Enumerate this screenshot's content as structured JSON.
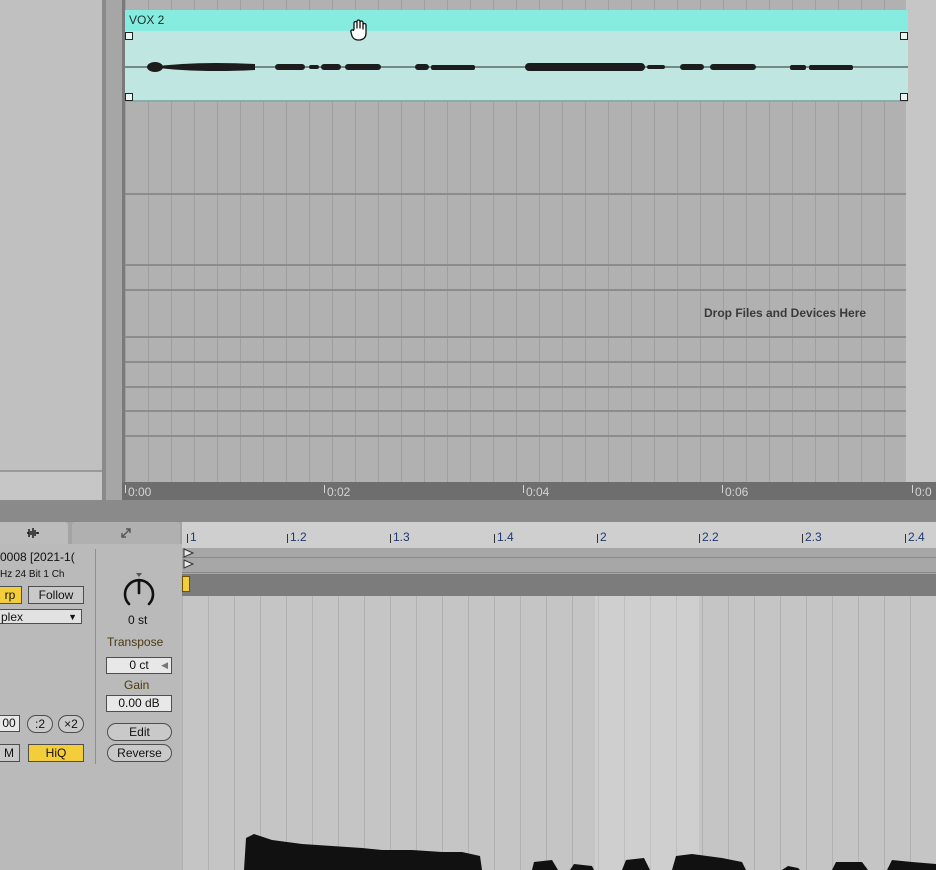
{
  "arrangement": {
    "clip": {
      "name": "VOX 2",
      "color": "#86ece0"
    },
    "drop_hint": "Drop Files and Devices Here",
    "time_ruler": [
      "0:00",
      "0:02",
      "0:04",
      "0:06",
      "0:0"
    ]
  },
  "clip_view": {
    "sample": {
      "name": "0008 [2021-1(",
      "format": "Hz  24 Bit  1 Ch",
      "warp_label": "rp",
      "follow_label": "Follow",
      "warp_mode": "plex",
      "tempo_value": "00",
      "halve_label": ":2",
      "double_label": "×2",
      "ram_label": "M",
      "hiq_label": "HiQ"
    },
    "transpose": {
      "value": "0 st",
      "label": "Transpose",
      "detune": "0 ct"
    },
    "gain": {
      "label": "Gain",
      "value": "0.00 dB"
    },
    "edit_label": "Edit",
    "reverse_label": "Reverse",
    "bar_ruler": [
      "1",
      "1.2",
      "1.3",
      "1.4",
      "2",
      "2.2",
      "2.3",
      "2.4"
    ]
  },
  "colors": {
    "accent": "#f4ce3a",
    "clip": "#86ece0"
  },
  "icons": {
    "hand_cursor": "hand-grab-icon",
    "tab_sample": "waveform-icon",
    "tab_envelope": "expand-arrows-icon"
  }
}
